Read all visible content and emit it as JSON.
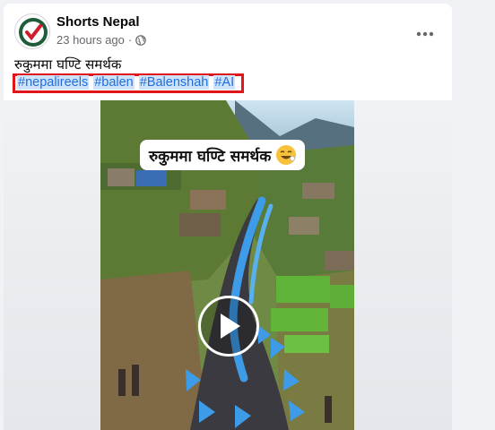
{
  "post": {
    "page_name": "Shorts Nepal",
    "timestamp": "23 hours ago",
    "dot": "·",
    "caption": "रुकुममा घण्टि समर्थक",
    "hashtags": [
      "#nepalireels",
      "#balen",
      "#Balenshah",
      "#AI"
    ]
  },
  "video": {
    "overlay_text": "रुकुममा घण्टि समर्थक"
  },
  "colors": {
    "link": "#216fdb",
    "highlight_box": "#e0161a",
    "flag_blue": "#3d9be8"
  },
  "icons": [
    "avatar-logo",
    "globe-icon",
    "more-options-icon",
    "play-icon",
    "laughing-emoji-icon"
  ]
}
